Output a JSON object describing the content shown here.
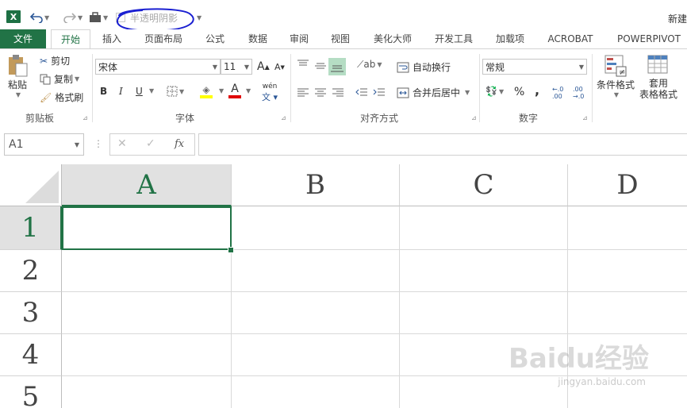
{
  "qat": {
    "logo": "X",
    "checkbox_label": "半透明阴影",
    "doc_title": "新建"
  },
  "tabs": [
    "文件",
    "开始",
    "插入",
    "页面布局",
    "公式",
    "数据",
    "审阅",
    "视图",
    "美化大师",
    "开发工具",
    "加载项",
    "ACROBAT",
    "POWERPIVOT"
  ],
  "ribbon": {
    "clipboard": {
      "paste": "粘贴",
      "cut": "剪切",
      "copy": "复制",
      "format_painter": "格式刷",
      "label": "剪贴板"
    },
    "font": {
      "name": "宋体",
      "size": "11",
      "bold": "B",
      "italic": "I",
      "underline": "U",
      "label": "字体",
      "grow": "A",
      "shrink": "A",
      "phonetic": "wén"
    },
    "alignment": {
      "wrap": "自动换行",
      "merge": "合并后居中",
      "label": "对齐方式"
    },
    "number": {
      "format": "常规",
      "percent": "%",
      "comma": ",",
      "inc_dec": "←.0 .00",
      "label": "数字"
    },
    "styles": {
      "conditional": "条件格式",
      "table_line1": "套用",
      "table_line2": "表格格式"
    }
  },
  "formula_bar": {
    "name_box": "A1",
    "cancel": "✕",
    "enter": "✓",
    "fx": "fx"
  },
  "grid": {
    "columns": [
      "A",
      "B",
      "C",
      "D"
    ],
    "rows": [
      "1",
      "2",
      "3",
      "4",
      "5"
    ],
    "selected_cell": "A1"
  },
  "watermark": {
    "text": "Baidu经验",
    "sub": "jingyan.baidu.com"
  }
}
